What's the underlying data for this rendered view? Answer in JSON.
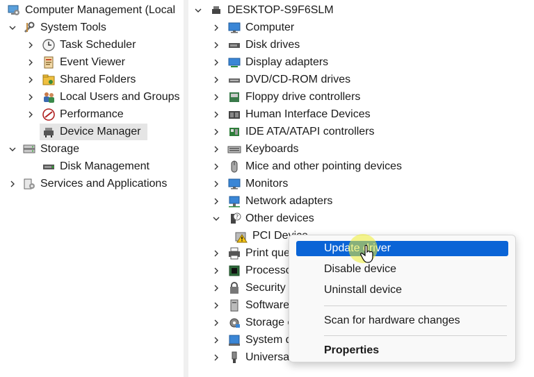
{
  "left_tree": {
    "root": "Computer Management (Local",
    "items": [
      {
        "label": "System Tools",
        "icon": "tools-icon"
      },
      {
        "label": "Task Scheduler",
        "icon": "clock-icon"
      },
      {
        "label": "Event Viewer",
        "icon": "event-viewer-icon"
      },
      {
        "label": "Shared Folders",
        "icon": "shared-folder-icon"
      },
      {
        "label": "Local Users and Groups",
        "icon": "users-icon"
      },
      {
        "label": "Performance",
        "icon": "performance-icon"
      },
      {
        "label": "Device Manager",
        "icon": "device-manager-icon"
      },
      {
        "label": "Storage",
        "icon": "storage-icon"
      },
      {
        "label": "Disk Management",
        "icon": "disk-icon"
      },
      {
        "label": "Services and Applications",
        "icon": "services-icon"
      }
    ]
  },
  "device_tree": {
    "root": "DESKTOP-S9F6SLM",
    "items": [
      {
        "label": "Computer",
        "icon": "monitor-icon"
      },
      {
        "label": "Disk drives",
        "icon": "disk-drive-icon"
      },
      {
        "label": "Display adapters",
        "icon": "display-adapter-icon"
      },
      {
        "label": "DVD/CD-ROM drives",
        "icon": "dvd-icon"
      },
      {
        "label": "Floppy drive controllers",
        "icon": "floppy-controller-icon"
      },
      {
        "label": "Human Interface Devices",
        "icon": "hid-icon"
      },
      {
        "label": "IDE ATA/ATAPI controllers",
        "icon": "ide-icon"
      },
      {
        "label": "Keyboards",
        "icon": "keyboard-icon"
      },
      {
        "label": "Mice and other pointing devices",
        "icon": "mouse-icon"
      },
      {
        "label": "Monitors",
        "icon": "monitor-icon"
      },
      {
        "label": "Network adapters",
        "icon": "network-icon"
      },
      {
        "label": "Other devices",
        "icon": "unknown-device-icon"
      },
      {
        "label": "PCI Device",
        "icon": "warning-device-icon"
      },
      {
        "label": "Print queues",
        "icon": "printer-icon"
      },
      {
        "label": "Processors",
        "icon": "processor-icon"
      },
      {
        "label": "Security devices",
        "icon": "security-icon"
      },
      {
        "label": "Software devices",
        "icon": "software-icon"
      },
      {
        "label": "Storage controllers",
        "icon": "storage-controller-icon"
      },
      {
        "label": "System devices",
        "icon": "system-icon"
      },
      {
        "label": "Universal Serial Bus controllers",
        "icon": "usb-icon"
      }
    ]
  },
  "context_menu": {
    "update_driver": "Update driver",
    "disable_device": "Disable device",
    "uninstall_device": "Uninstall device",
    "scan_hardware": "Scan for hardware changes",
    "properties": "Properties"
  },
  "colors": {
    "highlight": "#0a64d6",
    "selection": "#e5e5e5"
  }
}
